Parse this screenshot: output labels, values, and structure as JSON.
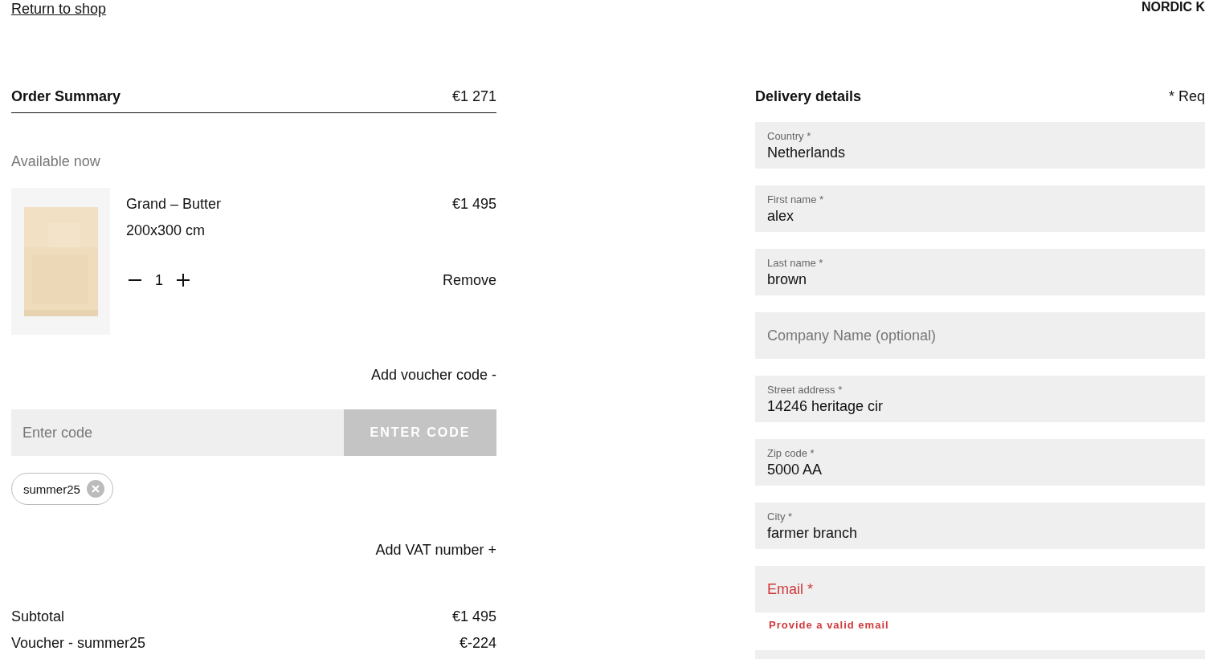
{
  "header": {
    "back_link": "Return to shop",
    "brand": "NORDIC K"
  },
  "order_summary": {
    "title": "Order Summary",
    "total": "€1 271",
    "availability": "Available now",
    "items": [
      {
        "kind": "picture",
        "name": "Grand – Butter",
        "size": "200x300 cm",
        "price": "€1 495",
        "quantity": "1",
        "remove": "Remove"
      }
    ],
    "voucher": {
      "toggle": "Add voucher code -",
      "placeholder": "Enter code",
      "button": "ENTER CODE",
      "button_disabled": true,
      "applied": [
        {
          "code": "summer25"
        }
      ]
    },
    "vat_toggle": "Add VAT number +",
    "totals": [
      {
        "label": "Subtotal",
        "value": "€1 495"
      },
      {
        "label": "Voucher - summer25",
        "value": "€-224"
      }
    ]
  },
  "delivery": {
    "title": "Delivery details",
    "required_note": "* Req",
    "fields": [
      {
        "kind": "filled",
        "label": "Country *",
        "value": "Netherlands"
      },
      {
        "kind": "filled",
        "label": "First name *",
        "value": "alex"
      },
      {
        "kind": "filled",
        "label": "Last name *",
        "value": "brown"
      },
      {
        "kind": "empty",
        "placeholder": "Company Name (optional)"
      },
      {
        "kind": "filled",
        "label": "Street address *",
        "value": "14246 heritage cir"
      },
      {
        "kind": "filled",
        "label": "Zip code *",
        "value": "5000 AA"
      },
      {
        "kind": "filled",
        "label": "City *",
        "value": "farmer branch"
      },
      {
        "kind": "error",
        "placeholder": "Email *",
        "error": "Provide a valid email"
      },
      {
        "kind": "cut"
      }
    ]
  }
}
